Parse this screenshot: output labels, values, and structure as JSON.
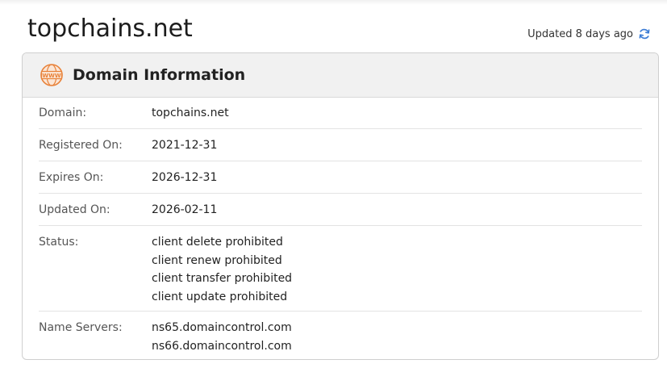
{
  "page": {
    "domain_title": "topchains.net",
    "updated_text": "Updated 8 days ago"
  },
  "card": {
    "title": "Domain Information",
    "icon": "www-globe-icon"
  },
  "rows": {
    "domain": {
      "label": "Domain:",
      "value": "topchains.net"
    },
    "registered": {
      "label": "Registered On:",
      "value": "2021-12-31"
    },
    "expires": {
      "label": "Expires On:",
      "value": "2026-12-31"
    },
    "updated": {
      "label": "Updated On:",
      "value": "2026-02-11"
    },
    "status": {
      "label": "Status:",
      "values": [
        "client delete prohibited",
        "client renew prohibited",
        "client transfer prohibited",
        "client update prohibited"
      ]
    },
    "nameservers": {
      "label": "Name Servers:",
      "values": [
        "ns65.domaincontrol.com",
        "ns66.domaincontrol.com"
      ]
    }
  },
  "colors": {
    "accent_orange": "#e8823a",
    "refresh_blue": "#3a7bd5"
  }
}
